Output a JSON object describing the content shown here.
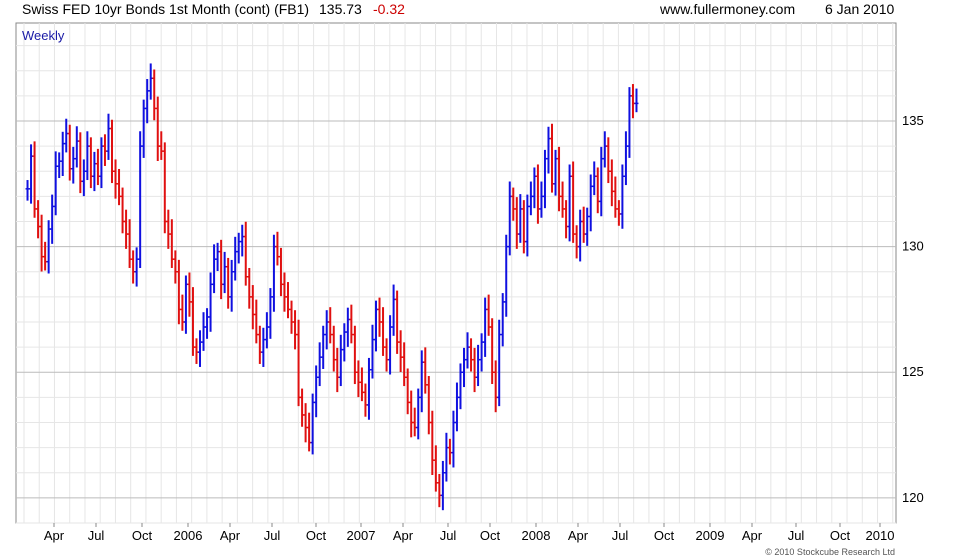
{
  "header": {
    "title": "Swiss FED 10yr Bonds 1st Month (cont) (FB1)",
    "price": "135.73",
    "change": "-0.32",
    "site": "www.fullermoney.com",
    "date": "6 Jan 2010"
  },
  "footer": {
    "copyright": "© 2010 Stockcube Research Ltd"
  },
  "colors": {
    "up": "#1010e0",
    "down": "#e01010",
    "grid": "#cccccc",
    "frame": "#888888",
    "change": "#cc0000",
    "label": "#1a1aa6"
  },
  "chart_data": {
    "type": "ohlc-bar",
    "frequency_label": "Weekly",
    "x_tick_labels": [
      "Apr",
      "Jul",
      "Oct",
      "2006",
      "Apr",
      "Jul",
      "Oct",
      "2007",
      "Apr",
      "Jul",
      "Oct",
      "2008",
      "Apr",
      "Jul",
      "Oct",
      "2009",
      "Apr",
      "Jul",
      "Oct",
      "2010"
    ],
    "y_ticks": [
      120,
      125,
      130,
      135
    ],
    "ylim": [
      119,
      138.9
    ],
    "x_range_weeks": [
      0,
      250
    ],
    "first_close": 132.3,
    "up_color": "#1010e0",
    "down_color": "#e01010",
    "closes": [
      132.3,
      133.6,
      131.5,
      130.8,
      129.6,
      129.4,
      130.7,
      131.6,
      133.2,
      133.4,
      134.1,
      134.5,
      133.1,
      133.5,
      134.2,
      132.6,
      133.0,
      134.0,
      132.8,
      133.3,
      132.8,
      134.0,
      133.8,
      134.7,
      133.0,
      132.5,
      132.0,
      131.0,
      130.5,
      129.5,
      129.0,
      129.5,
      134.0,
      135.5,
      136.2,
      136.7,
      135.5,
      134.0,
      133.8,
      131.0,
      130.5,
      129.5,
      129.0,
      127.5,
      127.0,
      128.5,
      127.8,
      126.0,
      125.8,
      126.2,
      126.8,
      127.2,
      128.5,
      129.5,
      129.8,
      128.5,
      129.2,
      128.0,
      129.0,
      129.8,
      130.2,
      130.4,
      128.8,
      128.0,
      127.3,
      126.5,
      125.8,
      126.3,
      126.8,
      128.0,
      130.0,
      129.6,
      128.5,
      128.0,
      127.5,
      127.0,
      126.5,
      124.0,
      123.3,
      122.8,
      122.2,
      123.8,
      124.8,
      125.6,
      126.5,
      127.0,
      126.5,
      125.5,
      124.8,
      125.9,
      126.6,
      127.1,
      126.5,
      125.0,
      124.6,
      124.2,
      123.7,
      125.1,
      126.3,
      127.5,
      127.0,
      126.0,
      125.5,
      126.8,
      127.9,
      126.2,
      125.6,
      124.8,
      123.8,
      123.0,
      122.8,
      124.0,
      125.4,
      124.5,
      123.0,
      121.5,
      120.6,
      120.1,
      121.0,
      122.0,
      121.8,
      123.0,
      124.0,
      125.0,
      125.5,
      126.0,
      125.5,
      124.8,
      125.5,
      126.2,
      127.5,
      126.8,
      125.0,
      124.0,
      126.5,
      127.8,
      130.0,
      132.0,
      131.5,
      130.5,
      131.5,
      130.2,
      131.6,
      132.0,
      132.8,
      131.5,
      132.0,
      133.5,
      134.3,
      132.5,
      133.5,
      132.0,
      131.5,
      130.8,
      132.8,
      130.5,
      130.0,
      131.0,
      130.5,
      131.2,
      132.4,
      132.8,
      131.8,
      133.5,
      134.0,
      133.0,
      132.2,
      131.5,
      131.3,
      132.8,
      134.0,
      136.0,
      135.7,
      135.7
    ]
  }
}
